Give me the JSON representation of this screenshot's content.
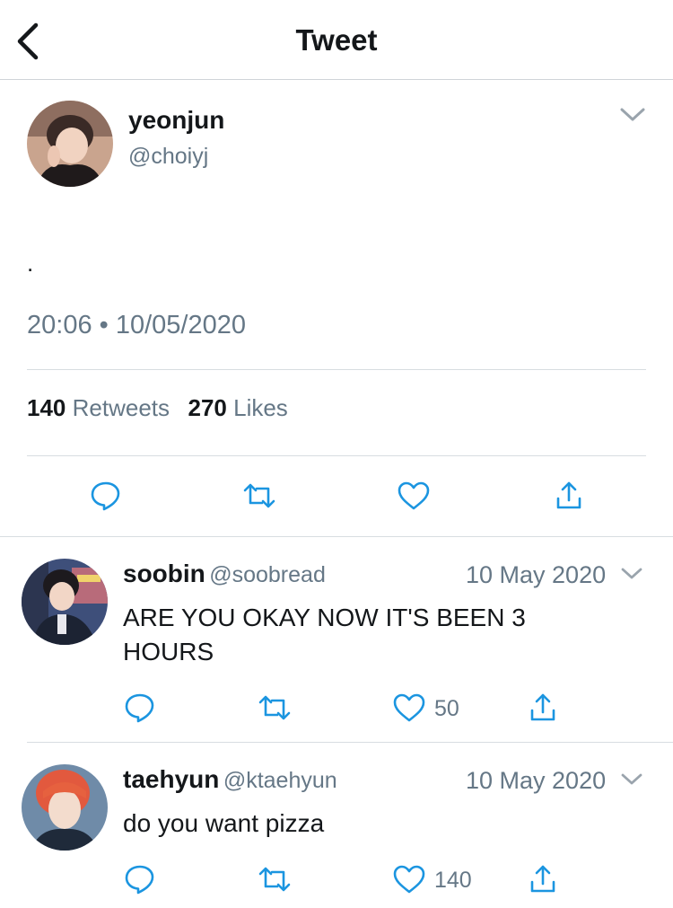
{
  "header": {
    "title": "Tweet"
  },
  "tweet": {
    "name": "yeonjun",
    "handle": "@choiyj",
    "text": ".",
    "time": "20:06",
    "separator": "•",
    "date": "10/05/2020",
    "retweets_count": "140",
    "retweets_label": "Retweets",
    "likes_count": "270",
    "likes_label": "Likes"
  },
  "replies": [
    {
      "name": "soobin",
      "handle": "@soobread",
      "date": "10 May 2020",
      "text_line1": "ARE YOU OKAY NOW IT'S BEEN 3",
      "text_line2": "HOURS",
      "likes": "50"
    },
    {
      "name": "taehyun",
      "handle": "@ktaehyun",
      "date": "10 May 2020",
      "text_line1": "do you want pizza",
      "likes": "140"
    }
  ],
  "icons": [
    "back-arrow-icon",
    "chevron-down-icon",
    "reply-icon",
    "retweet-icon",
    "like-icon",
    "share-icon"
  ],
  "colors": {
    "text": "#14171a",
    "secondary": "#657786",
    "divider": "#d8dde1",
    "icon": "#657786",
    "action_icon": "#1b95e0"
  }
}
